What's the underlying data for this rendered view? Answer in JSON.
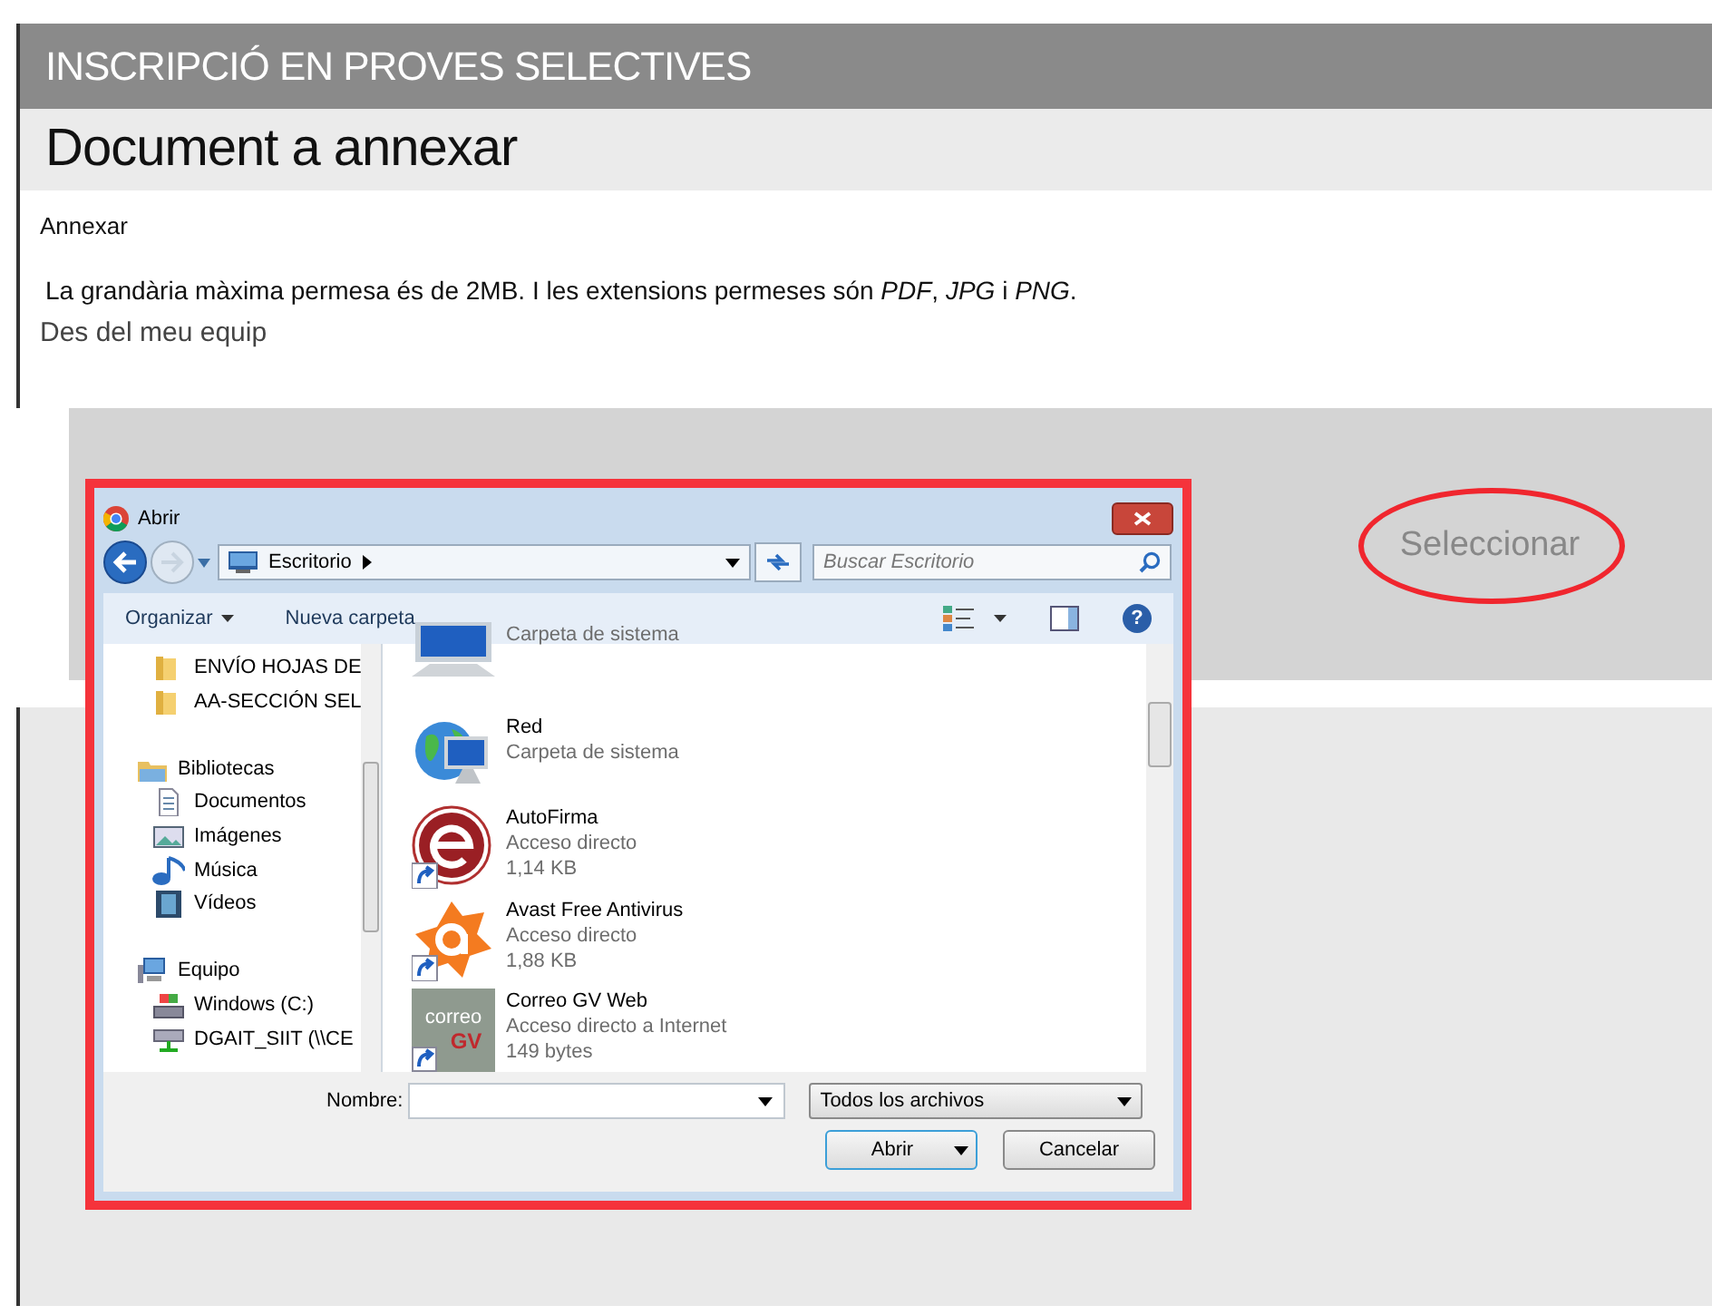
{
  "header": {
    "title": "INSCRIPCIÓ EN PROVES SELECTIVES"
  },
  "page_title": "Document a annexar",
  "section_label": "Annexar",
  "info_text": "La grandària màxima permesa és de 2MB. I les extensions permeses són *PDF*, *JPG* i *PNG*.",
  "source_label": "Des del meu equip",
  "select_button": {
    "label": "Seleccionar",
    "highlighted": true
  },
  "dialog": {
    "title": "Abrir",
    "path": "Escritorio",
    "search": {
      "placeholder": "Buscar Escritorio"
    },
    "toolbar": [
      "Organizar",
      "Nueva carpeta"
    ],
    "help_glyph": "?",
    "sidebar": [
      {
        "label": "ENVÍO HOJAS DE",
        "kind": "folder"
      },
      {
        "label": "AA-SECCIÓN SEL",
        "kind": "folder"
      },
      {
        "label": "Bibliotecas",
        "kind": "library",
        "children": [
          {
            "label": "Documentos",
            "kind": "documents"
          },
          {
            "label": "Imágenes",
            "kind": "images"
          },
          {
            "label": "Música",
            "kind": "music"
          },
          {
            "label": "Vídeos",
            "kind": "video"
          }
        ]
      },
      {
        "label": "Equipo",
        "kind": "computer",
        "children": [
          {
            "label": "Windows (C:)",
            "kind": "drive"
          },
          {
            "label": "DGAIT_SIIT (\\\\CE",
            "kind": "netdrive"
          }
        ]
      }
    ],
    "files": [
      {
        "kind": "computer",
        "details": [
          "Carpeta de sistema"
        ]
      },
      {
        "kind": "network",
        "name": "Red",
        "details": [
          "Carpeta de sistema"
        ]
      },
      {
        "kind": "autofirma",
        "name": "AutoFirma",
        "details": [
          "Acceso directo",
          "1,14 KB"
        ]
      },
      {
        "kind": "avast",
        "name": "Avast Free Antivirus",
        "details": [
          "Acceso directo",
          "1,88 KB"
        ]
      },
      {
        "kind": "correo",
        "logo_text": [
          "correo",
          "GV"
        ],
        "name": "Correo GV Web",
        "details": [
          "Acceso directo a Internet",
          "149 bytes"
        ]
      }
    ],
    "filename_label": "Nombre:",
    "filter": "Todos los archivos",
    "buttons": [
      "Abrir",
      "Cancelar"
    ]
  }
}
